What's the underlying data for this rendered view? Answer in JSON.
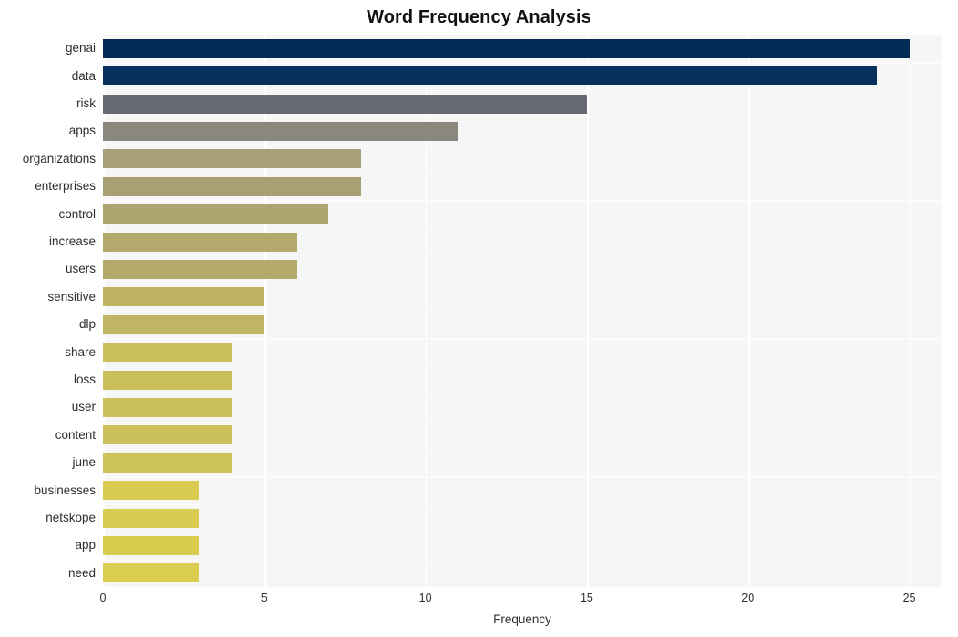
{
  "chart_data": {
    "type": "bar",
    "orientation": "horizontal",
    "title": "Word Frequency Analysis",
    "xlabel": "Frequency",
    "ylabel": "",
    "categories": [
      "genai",
      "data",
      "risk",
      "apps",
      "organizations",
      "enterprises",
      "control",
      "increase",
      "users",
      "sensitive",
      "dlp",
      "share",
      "loss",
      "user",
      "content",
      "june",
      "businesses",
      "netskope",
      "app",
      "need"
    ],
    "values": [
      25,
      24,
      15,
      11,
      8,
      8,
      7,
      6,
      6,
      5,
      5,
      4,
      4,
      4,
      4,
      4,
      3,
      3,
      3,
      3
    ],
    "colors": [
      "#042a57",
      "#07305f",
      "#666a72",
      "#8a887c",
      "#a79f75",
      "#a89f74",
      "#ada46f",
      "#b3a96c",
      "#b4aa6b",
      "#bfb463",
      "#c0b562",
      "#cbbf5b",
      "#cbbf5b",
      "#ccc05a",
      "#ccc05a",
      "#cdc159",
      "#d9cb50",
      "#dacc50",
      "#dacc4f",
      "#dbcd4f"
    ],
    "xticks": [
      0,
      5,
      10,
      15,
      20,
      25
    ],
    "xlim": [
      0,
      26
    ],
    "grid": true,
    "legend": null,
    "plot_background": "#f6f6f7",
    "gridline_color": "#ffffff",
    "colormap": "cividis"
  },
  "axes": {
    "x_tick_labels": [
      "0",
      "5",
      "10",
      "15",
      "20",
      "25"
    ],
    "x_title": "Frequency"
  }
}
